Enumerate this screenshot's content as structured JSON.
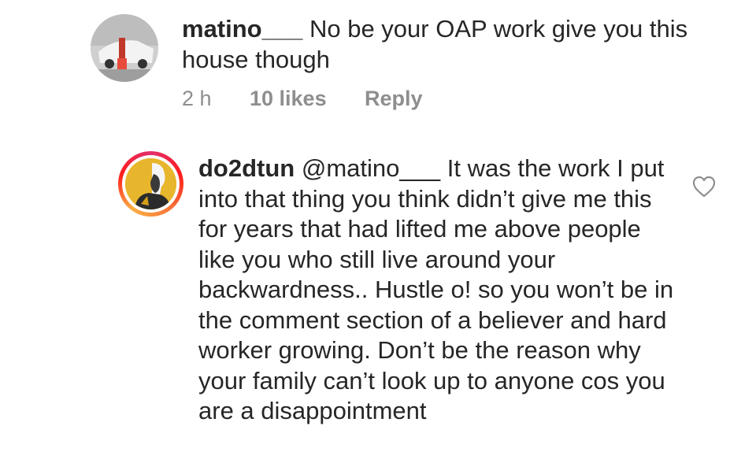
{
  "comment": {
    "username": "matino___",
    "text": "No be your OAP work give you this house though",
    "time": "2 h",
    "likes": "10 likes",
    "reply_label": "Reply"
  },
  "reply": {
    "username": "do2dtun",
    "mention": "@matino___",
    "text": "It was the work I put into that thing you think didn’t give me this for years that had lifted me above people like you who still live around your backwardness.. Hustle o! so you won’t be in the comment section of a believer and hard worker growing. Don’t be the reason why your family can’t look up to anyone cos you are a disappointment"
  },
  "icons": {
    "like": "heart-outline-icon"
  },
  "colors": {
    "text": "#262626",
    "muted": "#8e8e8e"
  }
}
